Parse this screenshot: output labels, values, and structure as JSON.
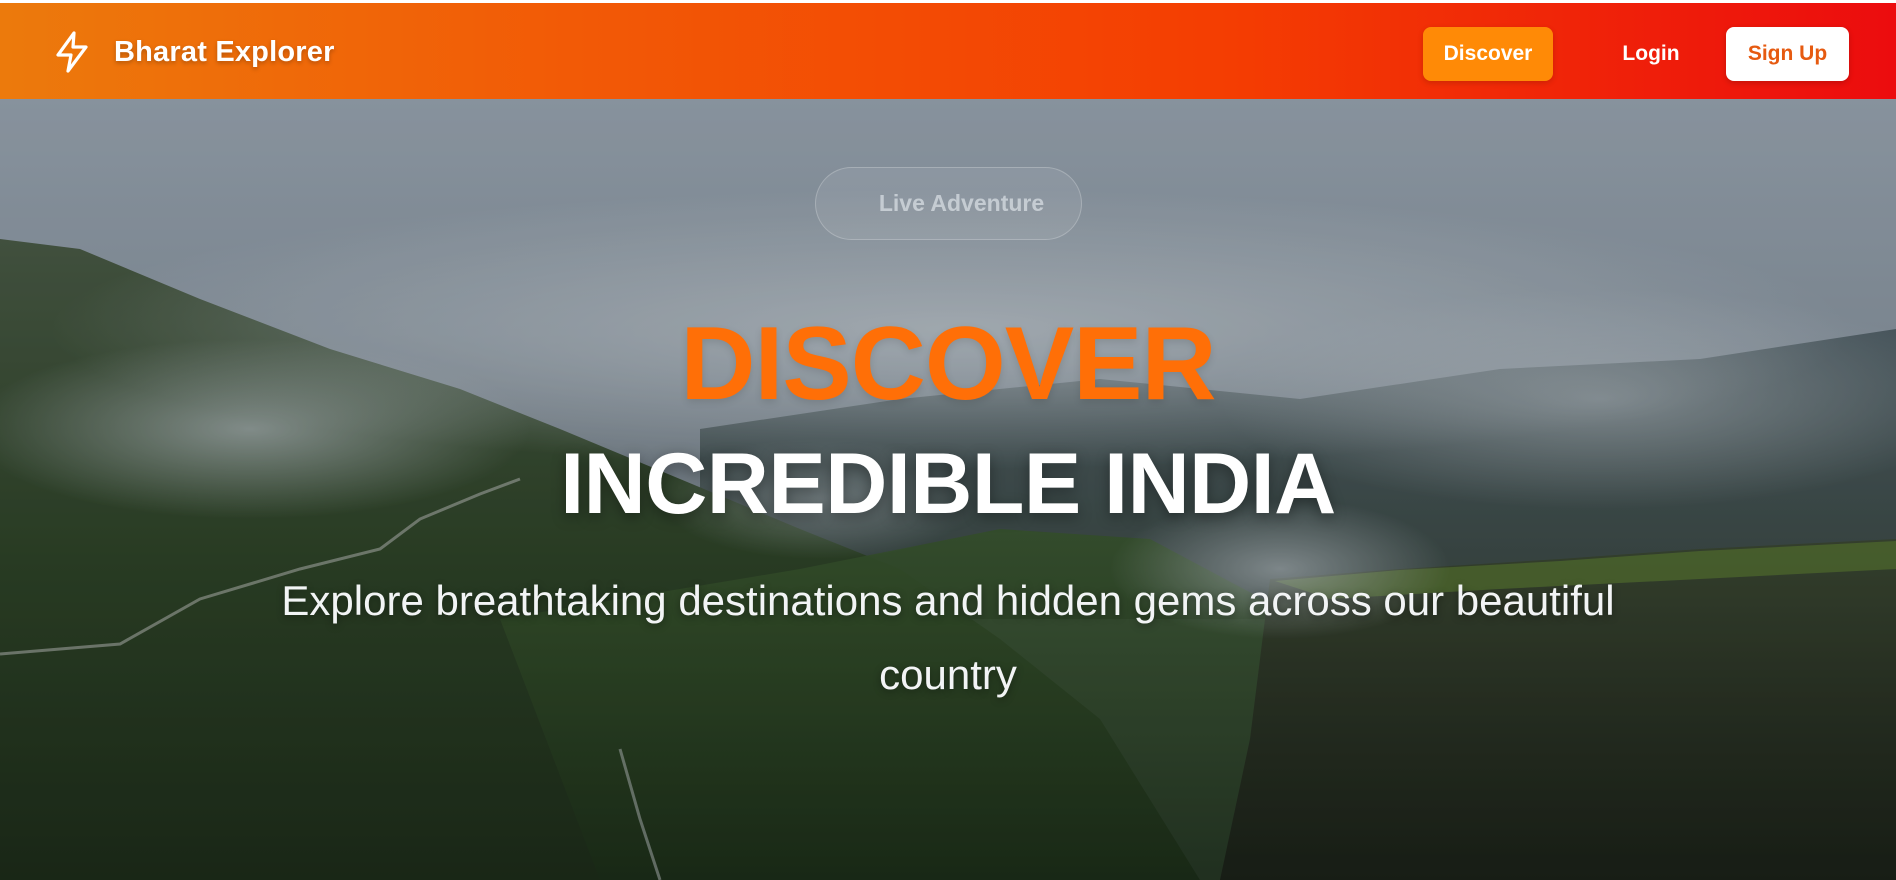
{
  "navbar": {
    "brand_name": "Bharat Explorer",
    "brand_icon": "lightning-bolt-icon",
    "discover_label": "Discover",
    "login_label": "Login",
    "signup_label": "Sign Up"
  },
  "hero": {
    "badge_text": "Live Adventure",
    "title_line1": "DISCOVER",
    "title_line2": "INCREDIBLE INDIA",
    "subtitle": "Explore breathtaking destinations and hidden gems across our beautiful country",
    "background_image": "misty-mountain-valley-photo"
  },
  "colors": {
    "nav_gradient_start": "#ec7a0c",
    "nav_gradient_end": "#ec0c0e",
    "accent_orange": "#ff6f07",
    "discover_button": "#ff8a06",
    "signup_text": "#e65a10"
  }
}
